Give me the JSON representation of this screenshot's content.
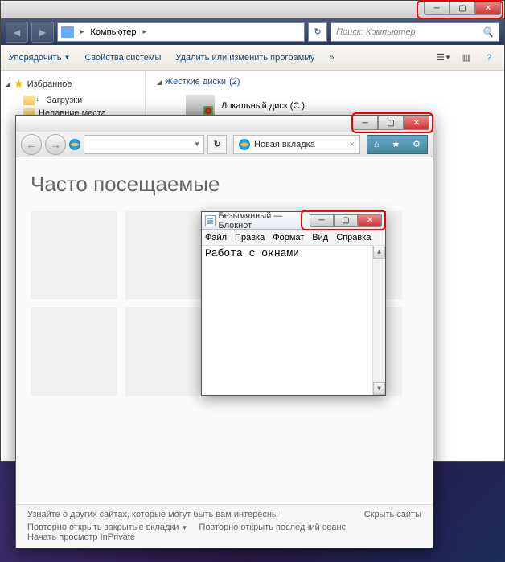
{
  "explorer": {
    "breadcrumb": "Компьютер",
    "breadcrumb_sep": "▸",
    "search_placeholder": "Поиск: Компьютер",
    "toolbar": {
      "organize": "Упорядочить",
      "properties": "Свойства системы",
      "uninstall": "Удалить или изменить программу",
      "more": "»"
    },
    "sidebar": {
      "favorites": "Избранное",
      "downloads": "Загрузки",
      "recent": "Недавние места"
    },
    "main": {
      "hdd_header": "Жесткие диски",
      "hdd_count": "(2)",
      "local_disk": "Локальный диск (C:)"
    },
    "controls": {
      "min": "─",
      "max": "▢",
      "close": "✕"
    }
  },
  "ie": {
    "tab_label": "Новая вкладка",
    "heading": "Часто посещаемые",
    "footer": {
      "learn": "Узнайте о других сайтах, которые могут быть вам интересны",
      "hide": "Скрыть сайты",
      "reopen_closed": "Повторно открыть закрытые вкладки",
      "reopen_last": "Повторно открыть последний сеанс",
      "inprivate": "Начать просмотр InPrivate"
    },
    "controls": {
      "min": "─",
      "max": "▢",
      "close": "✕"
    },
    "nav": {
      "back": "←",
      "forward": "→",
      "refresh": "↻",
      "home": "⌂",
      "star": "★",
      "gear": "⚙"
    }
  },
  "notepad": {
    "title": "Безымянный — Блокнот",
    "menu": {
      "file": "Файл",
      "edit": "Правка",
      "format": "Формат",
      "view": "Вид",
      "help": "Справка"
    },
    "content": "Работа с окнами",
    "controls": {
      "min": "─",
      "max": "▢",
      "close": "✕"
    }
  }
}
